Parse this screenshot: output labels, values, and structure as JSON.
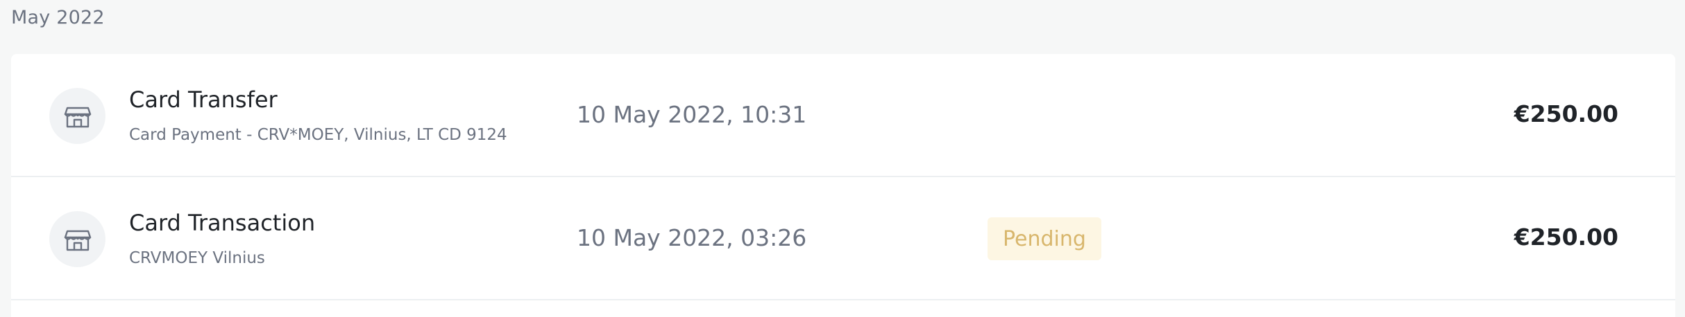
{
  "month_header": "May 2022",
  "transactions": [
    {
      "icon": "store-icon",
      "title": "Card Transfer",
      "subtitle": "Card Payment - CRV*MOEY, Vilnius, LT CD 9124",
      "datetime": "10 May 2022, 10:31",
      "status": "",
      "amount": "€250.00"
    },
    {
      "icon": "store-icon",
      "title": "Card Transaction",
      "subtitle": "CRVMOEY Vilnius",
      "datetime": "10 May 2022, 03:26",
      "status": "Pending",
      "amount": "€250.00"
    }
  ],
  "colors": {
    "page_bg": "#f6f7f7",
    "card_bg": "#ffffff",
    "muted_text": "#6b7280",
    "pending_bg": "#fdf6e3",
    "pending_text": "#d8b66c"
  }
}
